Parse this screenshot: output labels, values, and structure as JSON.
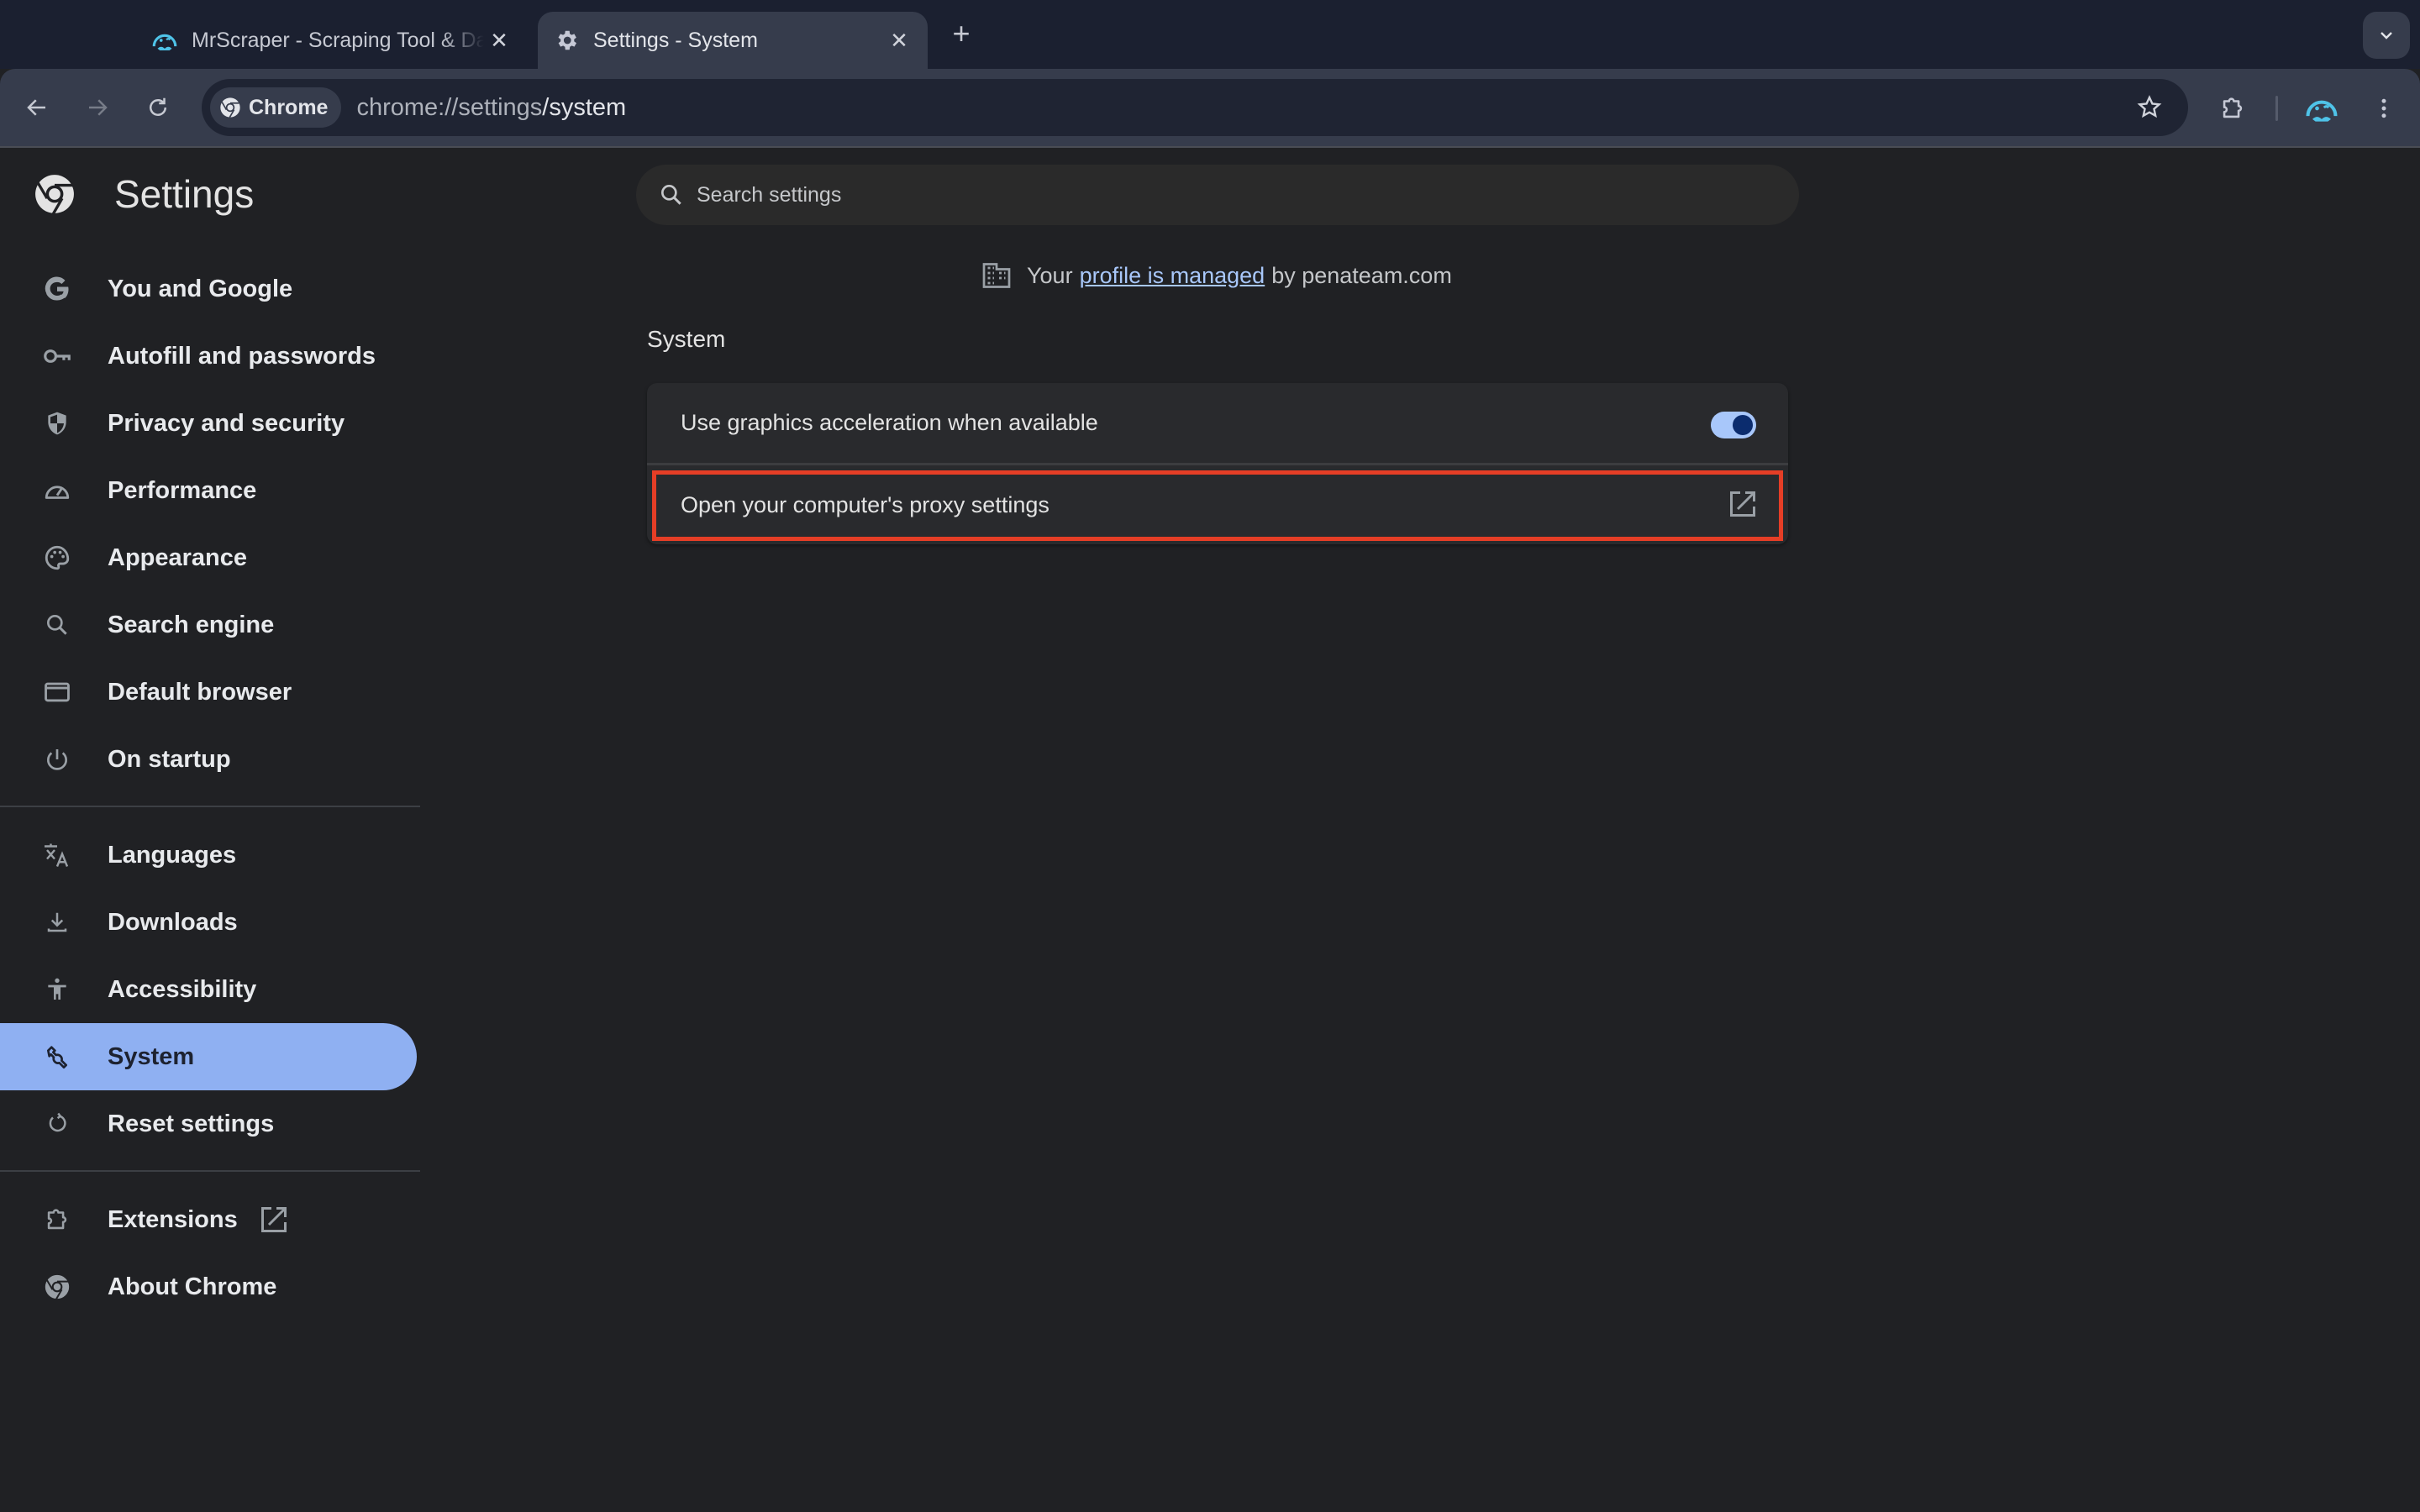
{
  "browser": {
    "tabs": [
      {
        "title": "MrScraper - Scraping Tool & Data Extraction",
        "favicon": "mrscraper-icon",
        "active": false
      },
      {
        "title": "Settings - System",
        "favicon": "gear-icon",
        "active": true
      }
    ],
    "omnibox": {
      "chip_label": "Chrome",
      "url_host": "chrome://settings",
      "url_path": "/system"
    },
    "colors": {
      "accent": "#a8c7fa",
      "profile": "#4fc3e8",
      "highlight": "#e53e26",
      "active_nav": "#8fb0f2"
    }
  },
  "sidebar": {
    "title": "Settings",
    "items": [
      {
        "label": "You and Google",
        "icon": "google-icon"
      },
      {
        "label": "Autofill and passwords",
        "icon": "key-icon"
      },
      {
        "label": "Privacy and security",
        "icon": "shield-icon"
      },
      {
        "label": "Performance",
        "icon": "speedometer-icon"
      },
      {
        "label": "Appearance",
        "icon": "palette-icon"
      },
      {
        "label": "Search engine",
        "icon": "search-icon"
      },
      {
        "label": "Default browser",
        "icon": "browser-window-icon"
      },
      {
        "label": "On startup",
        "icon": "power-icon"
      },
      {
        "label": "Languages",
        "icon": "translate-icon"
      },
      {
        "label": "Downloads",
        "icon": "download-icon"
      },
      {
        "label": "Accessibility",
        "icon": "accessibility-icon"
      },
      {
        "label": "System",
        "icon": "wrench-icon",
        "active": true
      },
      {
        "label": "Reset settings",
        "icon": "reset-icon"
      },
      {
        "label": "Extensions",
        "icon": "puzzle-icon",
        "external": true
      },
      {
        "label": "About Chrome",
        "icon": "chrome-icon"
      }
    ]
  },
  "main": {
    "search_placeholder": "Search settings",
    "managed": {
      "prefix": "Your",
      "link": "profile is managed",
      "suffix": "by penateam.com"
    },
    "section_title": "System",
    "settings": [
      {
        "label": "Use graphics acceleration when available",
        "type": "toggle",
        "value": true
      },
      {
        "label": "Open your computer's proxy settings",
        "type": "external-link",
        "highlighted": true
      }
    ]
  }
}
